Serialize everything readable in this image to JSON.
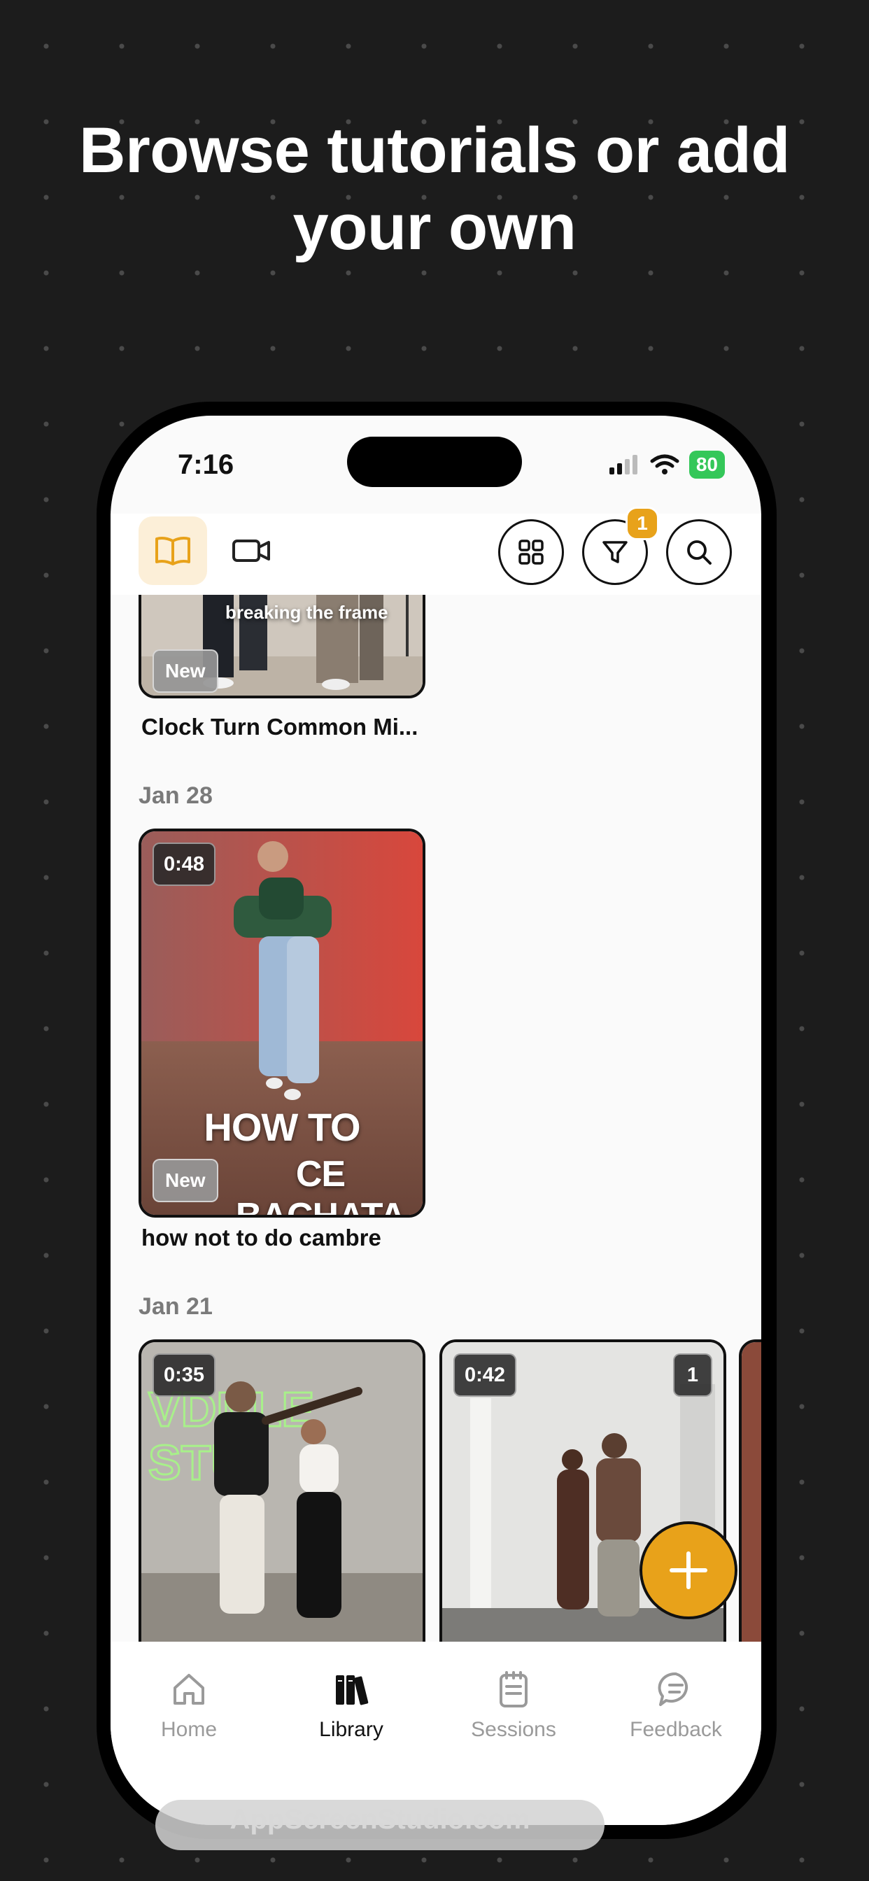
{
  "headline": {
    "line1": "Browse tutorials or add",
    "line2": "your own"
  },
  "status_bar": {
    "time": "7:16",
    "battery": "80"
  },
  "top_bar": {
    "filter_badge_count": "1",
    "icons": [
      "library-book-icon",
      "video-camera-icon",
      "grid-icon",
      "filter-icon",
      "search-icon"
    ]
  },
  "feed": {
    "first_card": {
      "overlay_text": "breaking the frame",
      "badge": "New",
      "title": "Clock Turn Common Mi..."
    },
    "section_jan28": {
      "date": "Jan 28",
      "card": {
        "duration": "0:48",
        "overlay_line1": "HOW TO",
        "overlay_line2": "CE BACHATA",
        "badge": "New",
        "title": "how not to do cambre"
      }
    },
    "section_jan21": {
      "date": "Jan 21",
      "cards": [
        {
          "duration": "0:35"
        },
        {
          "duration": "0:42",
          "count": "1"
        }
      ]
    }
  },
  "fab": {
    "icon": "plus-icon"
  },
  "tab_bar": {
    "items": [
      {
        "label": "Home",
        "icon": "home-icon",
        "active": false
      },
      {
        "label": "Library",
        "icon": "library-icon",
        "active": true
      },
      {
        "label": "Sessions",
        "icon": "clipboard-icon",
        "active": false
      },
      {
        "label": "Feedback",
        "icon": "chat-bubble-icon",
        "active": false
      }
    ]
  },
  "watermark": "AppScreenStudio.com",
  "colors": {
    "accent": "#e8a21a",
    "background": "#1c1c1c",
    "battery": "#34c759"
  }
}
